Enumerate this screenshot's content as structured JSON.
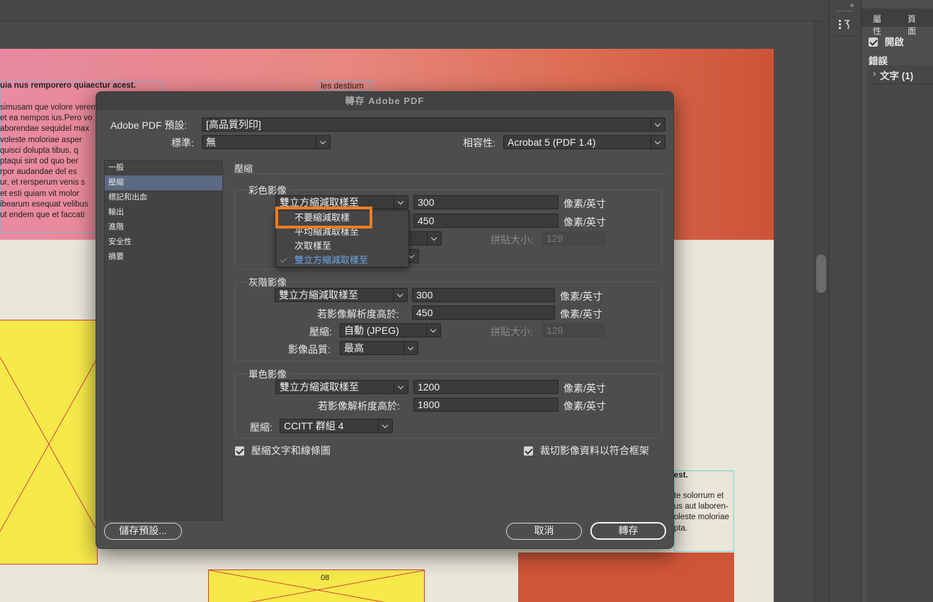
{
  "document": {
    "bold_line": "uia nus remporero quiaectur acest.",
    "text_lines": [
      "simusam que volore verem faccate solo-",
      "et ea nempos ius.Pero vo",
      "aborendae sequidel max",
      "voleste moloriae asper",
      " quisci dolupta tibus, q",
      "ptaqui sint od quo ber",
      "rpor audandae del es",
      "ur, et rersperum venis s",
      " et esti quiam vit molor",
      "ibearum esequat velibus",
      "ut endem que et faccati"
    ],
    "heading_small": "les destium",
    "page_number": "08",
    "right_bold": "est.",
    "right_lines": [
      "te solorrum et",
      "us aut laboren-",
      "oleste moloriae",
      "pta."
    ]
  },
  "right_panel": {
    "tab_properties": "屬性",
    "tab_pages": "頁面",
    "open_label": "開啟",
    "errors_label": "錯誤",
    "text_item": "文字 (1)"
  },
  "dialog": {
    "title": "轉存 Adobe PDF",
    "preset_label": "Adobe PDF 預設:",
    "preset_value": "[高品質列印]",
    "standard_label": "標準:",
    "standard_value": "無",
    "compat_label": "相容性:",
    "compat_value": "Acrobat 5 (PDF 1.4)",
    "sidebar": [
      "一般",
      "壓縮",
      "標記和出血",
      "輸出",
      "進階",
      "安全性",
      "摘要"
    ],
    "section_title": "壓縮",
    "color": {
      "title": "彩色影像",
      "sampling": "雙立方縮減取樣至",
      "ppi": "300",
      "above": "450",
      "unit": "像素/英寸",
      "tile_label": "拼貼大小:",
      "tile_value": "128"
    },
    "gray": {
      "title": "灰階影像",
      "sampling": "雙立方縮減取樣至",
      "ppi": "300",
      "above_label": "若影像解析度高於:",
      "above": "450",
      "unit": "像素/英寸",
      "compression_label": "壓縮:",
      "compression": "自動 (JPEG)",
      "tile_label": "拼貼大小:",
      "tile_value": "128",
      "quality_label": "影像品質:",
      "quality": "最高"
    },
    "mono": {
      "title": "單色影像",
      "sampling": "雙立方縮減取樣至",
      "ppi": "1200",
      "above_label": "若影像解析度高於:",
      "above": "1800",
      "unit": "像素/英寸",
      "compression_label": "壓縮:",
      "compression": "CCITT 群組 4"
    },
    "compress_text_label": "壓縮文字和線條圖",
    "crop_label": "裁切影像資料以符合框架",
    "save_preset_button": "儲存預設...",
    "cancel_button": "取消",
    "export_button": "轉存",
    "popup_options": [
      "不要縮減取樣",
      "平均縮減取樣至",
      "次取樣至",
      "雙立方縮減取樣至"
    ],
    "highlight_color": "#ef7c21",
    "checked_color": "#6ea7ea"
  }
}
